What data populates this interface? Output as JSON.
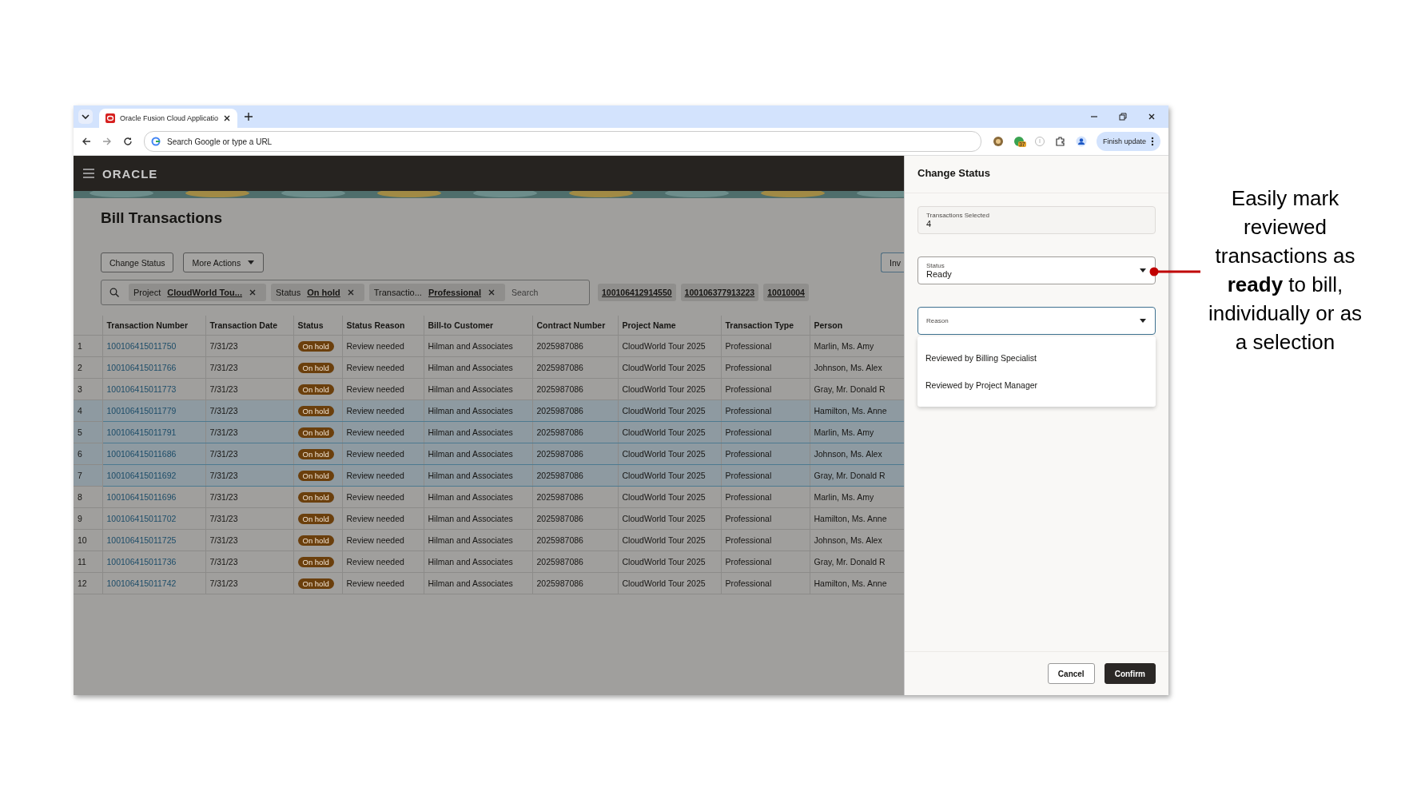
{
  "browser": {
    "tab_title": "Oracle Fusion Cloud Applicatio",
    "address_placeholder": "Search Google or type a URL",
    "extension_badge": "37",
    "update_button": "Finish update"
  },
  "app": {
    "brand": "ORACLE",
    "page_title": "Bill Transactions",
    "actions": [
      {
        "label": "Change Status",
        "kind": "button"
      },
      {
        "label": "More Actions",
        "kind": "menu"
      }
    ],
    "right_button": "Inv",
    "filters": [
      {
        "label": "Project",
        "value": "CloudWorld Tou..."
      },
      {
        "label": "Status",
        "value": "On hold"
      },
      {
        "label": "Transactio...",
        "value": "Professional"
      }
    ],
    "search_placeholder": "Search",
    "recent_chips": [
      "100106412914550",
      "100106377913223",
      "10010004"
    ],
    "table": {
      "columns": [
        "Transaction Number",
        "Transaction Date",
        "Status",
        "Status Reason",
        "Bill-to Customer",
        "Contract Number",
        "Project Name",
        "Transaction Type",
        "Person"
      ],
      "rows": [
        {
          "number": "1",
          "transaction": "100106415011750",
          "date": "7/31/23",
          "status": "On hold",
          "reason": "Review needed",
          "customer": "Hilman and Associates",
          "contract": "2025987086",
          "project": "CloudWorld Tour 2025",
          "type": "Professional",
          "person": "Marlin, Ms. Amy",
          "selected": false
        },
        {
          "number": "2",
          "transaction": "100106415011766",
          "date": "7/31/23",
          "status": "On hold",
          "reason": "Review needed",
          "customer": "Hilman and Associates",
          "contract": "2025987086",
          "project": "CloudWorld Tour 2025",
          "type": "Professional",
          "person": "Johnson, Ms. Alex",
          "selected": false
        },
        {
          "number": "3",
          "transaction": "100106415011773",
          "date": "7/31/23",
          "status": "On hold",
          "reason": "Review needed",
          "customer": "Hilman and Associates",
          "contract": "2025987086",
          "project": "CloudWorld Tour 2025",
          "type": "Professional",
          "person": "Gray, Mr. Donald R",
          "selected": false
        },
        {
          "number": "4",
          "transaction": "100106415011779",
          "date": "7/31/23",
          "status": "On hold",
          "reason": "Review needed",
          "customer": "Hilman and Associates",
          "contract": "2025987086",
          "project": "CloudWorld Tour 2025",
          "type": "Professional",
          "person": "Hamilton, Ms. Anne",
          "selected": true
        },
        {
          "number": "5",
          "transaction": "100106415011791",
          "date": "7/31/23",
          "status": "On hold",
          "reason": "Review needed",
          "customer": "Hilman and Associates",
          "contract": "2025987086",
          "project": "CloudWorld Tour 2025",
          "type": "Professional",
          "person": "Marlin, Ms. Amy",
          "selected": true
        },
        {
          "number": "6",
          "transaction": "100106415011686",
          "date": "7/31/23",
          "status": "On hold",
          "reason": "Review needed",
          "customer": "Hilman and Associates",
          "contract": "2025987086",
          "project": "CloudWorld Tour 2025",
          "type": "Professional",
          "person": "Johnson, Ms. Alex",
          "selected": true
        },
        {
          "number": "7",
          "transaction": "100106415011692",
          "date": "7/31/23",
          "status": "On hold",
          "reason": "Review needed",
          "customer": "Hilman and Associates",
          "contract": "2025987086",
          "project": "CloudWorld Tour 2025",
          "type": "Professional",
          "person": "Gray, Mr. Donald R",
          "selected": true
        },
        {
          "number": "8",
          "transaction": "100106415011696",
          "date": "7/31/23",
          "status": "On hold",
          "reason": "Review needed",
          "customer": "Hilman and Associates",
          "contract": "2025987086",
          "project": "CloudWorld Tour 2025",
          "type": "Professional",
          "person": "Marlin, Ms. Amy",
          "selected": false
        },
        {
          "number": "9",
          "transaction": "100106415011702",
          "date": "7/31/23",
          "status": "On hold",
          "reason": "Review needed",
          "customer": "Hilman and Associates",
          "contract": "2025987086",
          "project": "CloudWorld Tour 2025",
          "type": "Professional",
          "person": "Hamilton, Ms. Anne",
          "selected": false
        },
        {
          "number": "10",
          "transaction": "100106415011725",
          "date": "7/31/23",
          "status": "On hold",
          "reason": "Review needed",
          "customer": "Hilman and Associates",
          "contract": "2025987086",
          "project": "CloudWorld Tour 2025",
          "type": "Professional",
          "person": "Johnson, Ms. Alex",
          "selected": false
        },
        {
          "number": "11",
          "transaction": "100106415011736",
          "date": "7/31/23",
          "status": "On hold",
          "reason": "Review needed",
          "customer": "Hilman and Associates",
          "contract": "2025987086",
          "project": "CloudWorld Tour 2025",
          "type": "Professional",
          "person": "Gray, Mr. Donald R",
          "selected": false
        },
        {
          "number": "12",
          "transaction": "100106415011742",
          "date": "7/31/23",
          "status": "On hold",
          "reason": "Review needed",
          "customer": "Hilman and Associates",
          "contract": "2025987086",
          "project": "CloudWorld Tour 2025",
          "type": "Professional",
          "person": "Hamilton, Ms. Anne",
          "selected": false
        }
      ]
    }
  },
  "panel": {
    "title": "Change Status",
    "fields": [
      {
        "kind": "readonly",
        "label": "Transactions Selected",
        "value": "4"
      },
      {
        "kind": "select",
        "label": "Status",
        "value": "Ready"
      },
      {
        "kind": "select",
        "label": "Reason",
        "focused": true
      }
    ],
    "options": [
      "Reviewed by Billing Specialist",
      "Reviewed by Project Manager"
    ],
    "buttons": [
      {
        "label": "Cancel",
        "kind": "secondary"
      },
      {
        "label": "Confirm",
        "kind": "primary"
      }
    ]
  },
  "annotation": "Easily mark reviewed transactions as **ready** to bill, individually or as a selection"
}
